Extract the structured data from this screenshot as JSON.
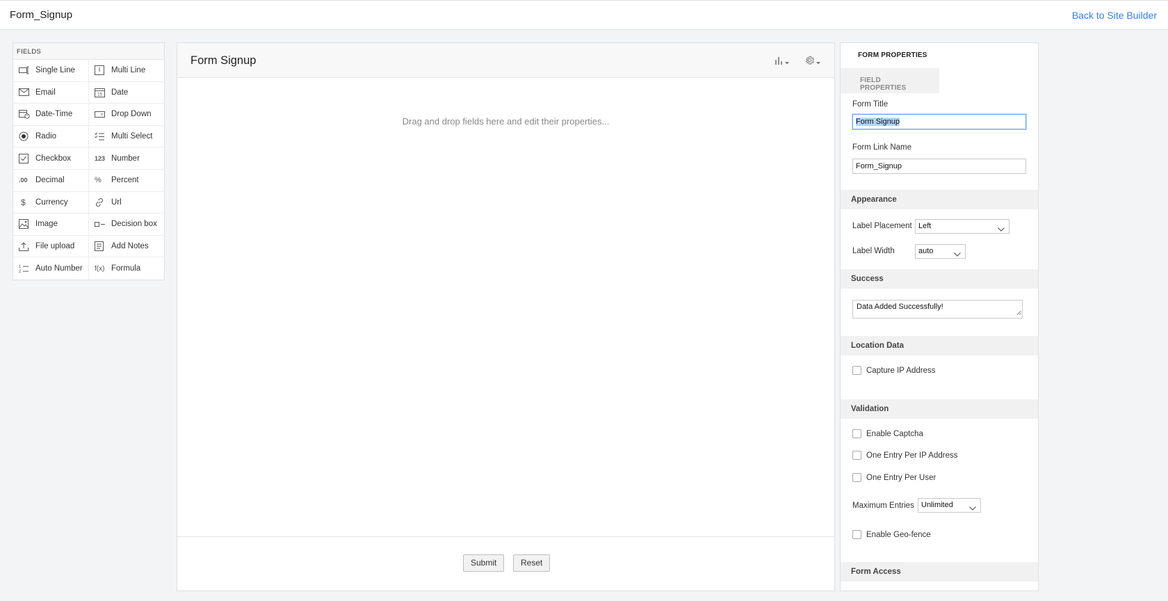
{
  "topbar": {
    "title": "Form_Signup",
    "back_link": "Back to Site Builder"
  },
  "fields_panel": {
    "header": "FIELDS",
    "items": [
      {
        "label": "Single Line",
        "icon": "single-line-icon"
      },
      {
        "label": "Multi Line",
        "icon": "multi-line-icon"
      },
      {
        "label": "Email",
        "icon": "email-icon"
      },
      {
        "label": "Date",
        "icon": "date-icon"
      },
      {
        "label": "Date-Time",
        "icon": "date-time-icon"
      },
      {
        "label": "Drop Down",
        "icon": "dropdown-icon"
      },
      {
        "label": "Radio",
        "icon": "radio-icon"
      },
      {
        "label": "Multi Select",
        "icon": "multi-select-icon"
      },
      {
        "label": "Checkbox",
        "icon": "checkbox-icon"
      },
      {
        "label": "Number",
        "icon": "number-icon"
      },
      {
        "label": "Decimal",
        "icon": "decimal-icon"
      },
      {
        "label": "Percent",
        "icon": "percent-icon"
      },
      {
        "label": "Currency",
        "icon": "currency-icon"
      },
      {
        "label": "Url",
        "icon": "url-icon"
      },
      {
        "label": "Image",
        "icon": "image-icon"
      },
      {
        "label": "Decision box",
        "icon": "decision-box-icon"
      },
      {
        "label": "File upload",
        "icon": "file-upload-icon"
      },
      {
        "label": "Add Notes",
        "icon": "add-notes-icon"
      },
      {
        "label": "Auto Number",
        "icon": "auto-number-icon"
      },
      {
        "label": "Formula",
        "icon": "formula-icon"
      }
    ],
    "icon_text": {
      "date": "15",
      "number": "123",
      "decimal": ".00",
      "percent": "%",
      "currency": "$",
      "formula": "f(x)"
    }
  },
  "canvas": {
    "title": "Form Signup",
    "drop_hint": "Drag and drop fields here and edit their properties...",
    "submit_label": "Submit",
    "reset_label": "Reset"
  },
  "properties": {
    "tab_form": "FORM PROPERTIES",
    "tab_field": "FIELD PROPERTIES",
    "form_title_label": "Form Title",
    "form_title_value": "Form Signup",
    "form_link_label": "Form Link Name",
    "form_link_value": "Form_Signup",
    "appearance": {
      "header": "Appearance",
      "label_placement_label": "Label Placement",
      "label_placement_value": "Left",
      "label_width_label": "Label Width",
      "label_width_value": "auto"
    },
    "success": {
      "header": "Success",
      "message": "Data Added Successfully!"
    },
    "location": {
      "header": "Location Data",
      "capture_ip": "Capture IP Address"
    },
    "validation": {
      "header": "Validation",
      "enable_captcha": "Enable Captcha",
      "one_per_ip": "One Entry Per IP Address",
      "one_per_user": "One Entry Per User",
      "max_entries_label": "Maximum Entries",
      "max_entries_value": "Unlimited",
      "geo_fence": "Enable Geo-fence"
    },
    "form_access": {
      "header": "Form Access"
    }
  },
  "colors": {
    "accent": "#2f80ed",
    "background": "#f3f4f5",
    "selection": "#b4d4fb"
  }
}
